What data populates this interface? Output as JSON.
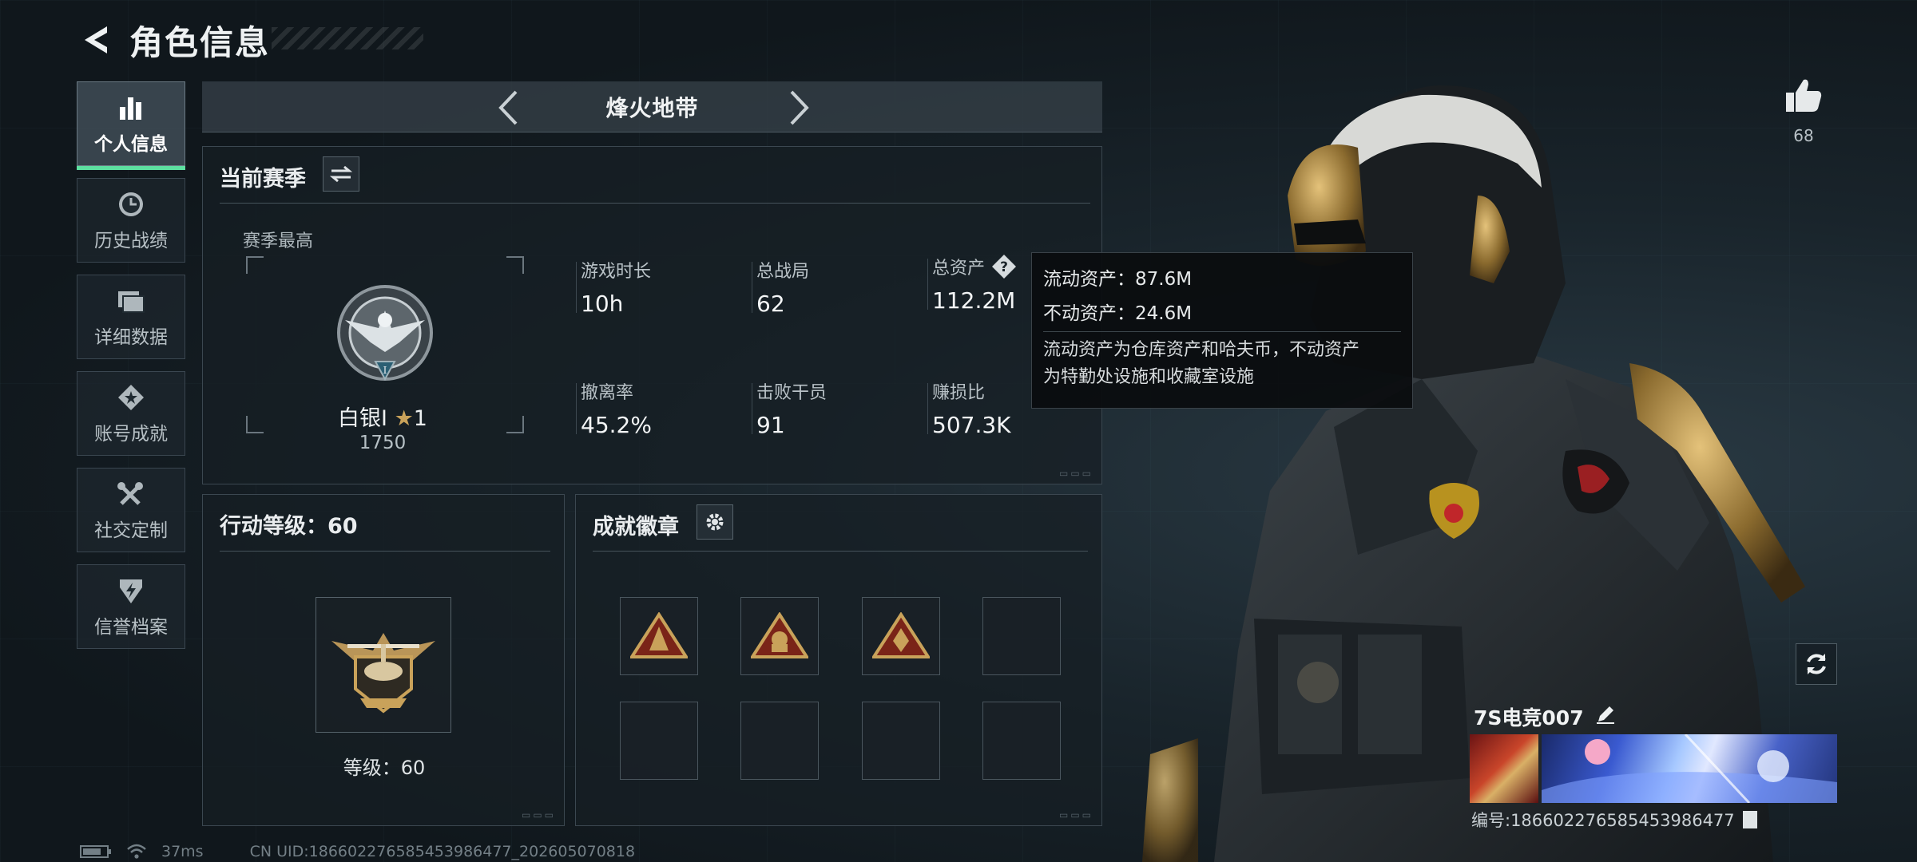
{
  "header": {
    "title": "角色信息"
  },
  "sidebar": {
    "items": [
      {
        "label": "个人信息",
        "icon": "bar-chart-icon",
        "active": true
      },
      {
        "label": "历史战绩",
        "icon": "clock-icon"
      },
      {
        "label": "详细数据",
        "icon": "folder-icon"
      },
      {
        "label": "账号成就",
        "icon": "achievement-diamond-icon"
      },
      {
        "label": "社交定制",
        "icon": "wrench-icon"
      },
      {
        "label": "信誉档案",
        "icon": "shield-bolt-icon"
      }
    ]
  },
  "mode": {
    "label": "烽火地带"
  },
  "season": {
    "title": "当前赛季",
    "best_label": "赛季最高",
    "rank_name": "白银Ⅰ",
    "rank_stars": "1",
    "rank_score": "1750",
    "stats": [
      {
        "key": "游戏时长",
        "value": "10h"
      },
      {
        "key": "总战局",
        "value": "62"
      },
      {
        "key": "总资产",
        "value": "112.2M"
      },
      {
        "key": "撤离率",
        "value": "45.2%"
      },
      {
        "key": "击败干员",
        "value": "91"
      },
      {
        "key": "赚损比",
        "value": "507.3K"
      }
    ]
  },
  "tooltip": {
    "liquid": "流动资产：87.6M",
    "fixed": "不动资产：24.6M",
    "desc_line1": "流动资产为仓库资产和哈夫币，不动资产",
    "desc_line2": "为特勤处设施和收藏室设施"
  },
  "level": {
    "title": "行动等级：60",
    "label": "等级：60"
  },
  "achievements": {
    "title": "成就徽章",
    "slots": [
      "filled",
      "filled",
      "filled",
      "empty",
      "empty",
      "empty",
      "empty",
      "empty"
    ]
  },
  "player": {
    "like_count": "68",
    "name": "7S电竞007",
    "id": "编号:186602276585453986477"
  },
  "footer": {
    "ping": "37ms",
    "uid": "CN UID:186602276585453986477_202605070818"
  },
  "colors": {
    "accent_green": "#5de0a0",
    "gold": "#c9a25a"
  }
}
